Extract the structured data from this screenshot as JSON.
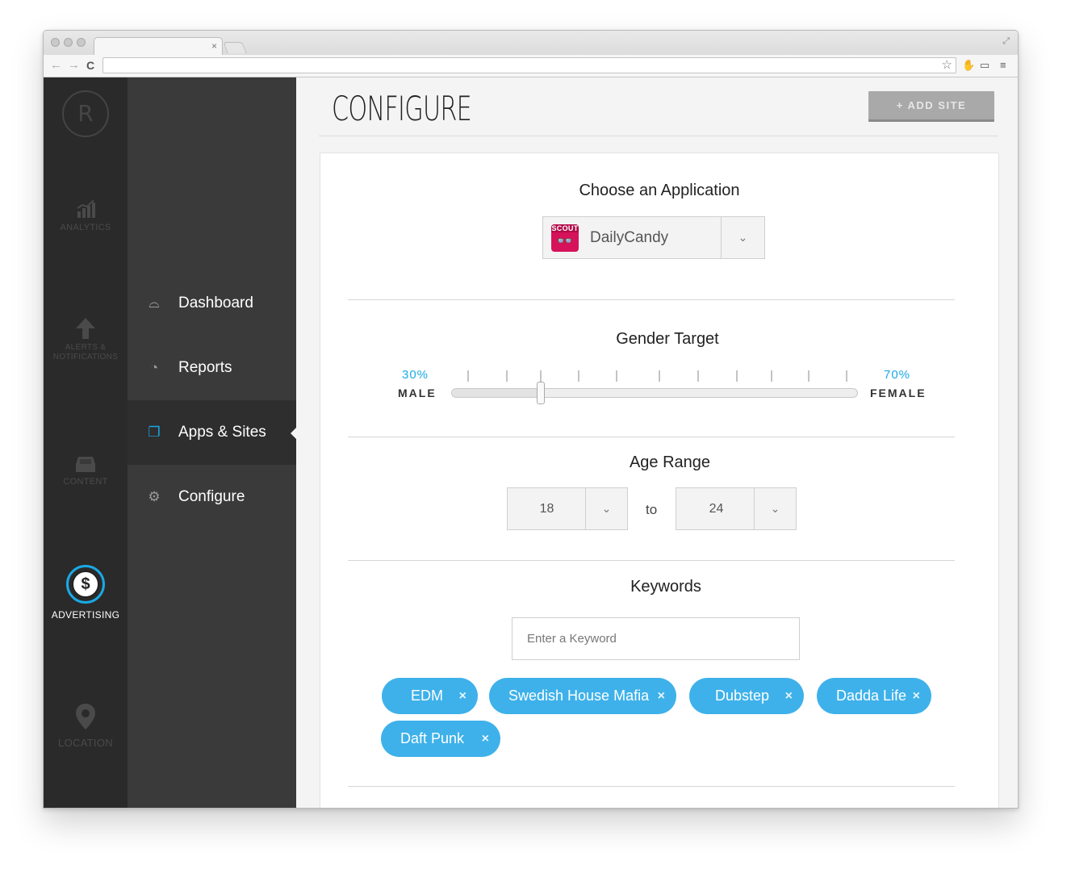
{
  "browser": {
    "tab_close": "×",
    "back": "←",
    "forward": "→",
    "reload": "C",
    "star": "☆"
  },
  "rail": {
    "logo": "R",
    "items": [
      {
        "label": "ANALYTICS",
        "icon": "bar-chart-icon"
      },
      {
        "label": "ALERTS & NOTIFICATIONS",
        "icon": "arrow-up-icon"
      },
      {
        "label": "CONTENT",
        "icon": "inbox-icon"
      },
      {
        "label": "ADVERTISING",
        "icon": "dollar-icon"
      },
      {
        "label": "LOCATION",
        "icon": "map-pin-icon"
      }
    ]
  },
  "subnav": {
    "items": [
      {
        "label": "Dashboard",
        "icon": "dashboard-icon"
      },
      {
        "label": "Reports",
        "icon": "pie-chart-icon"
      },
      {
        "label": "Apps & Sites",
        "icon": "windows-icon"
      },
      {
        "label": "Configure",
        "icon": "gear-icon"
      }
    ],
    "active": "Apps & Sites"
  },
  "header": {
    "title": "CONFIGURE",
    "add_site": "+ ADD SITE"
  },
  "application": {
    "title": "Choose an Application",
    "selected": "DailyCandy",
    "icon_text": "SCOUT"
  },
  "gender": {
    "title": "Gender Target",
    "male_pct": "30%",
    "male_label": "MALE",
    "female_pct": "70%",
    "female_label": "FEMALE",
    "slider_male_fraction": 0.22
  },
  "age": {
    "title": "Age Range",
    "from": "18",
    "to_label": "to",
    "to": "24"
  },
  "keywords": {
    "title": "Keywords",
    "placeholder": "Enter a Keyword",
    "tags": [
      "EDM",
      "Swedish House Mafia",
      "Dubstep",
      "Dadda Life",
      "Daft Punk"
    ],
    "remove_glyph": "×"
  },
  "colors": {
    "accent": "#1aa9e6",
    "tag": "#3eb1ea",
    "rail": "#2a2a2a",
    "subnav": "#3a3a3a"
  }
}
